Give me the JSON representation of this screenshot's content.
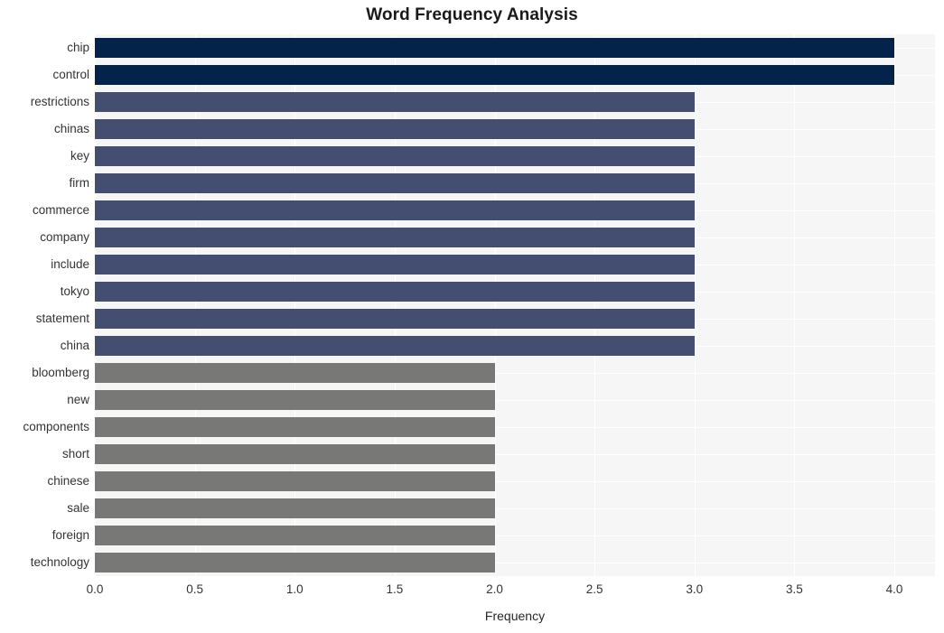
{
  "chart_data": {
    "type": "bar",
    "orientation": "horizontal",
    "title": "Word Frequency Analysis",
    "xlabel": "Frequency",
    "ylabel": "",
    "xlim": [
      0,
      4.0
    ],
    "xticks": [
      "0.0",
      "0.5",
      "1.0",
      "1.5",
      "2.0",
      "2.5",
      "3.0",
      "3.5",
      "4.0"
    ],
    "xtick_values": [
      0.0,
      0.5,
      1.0,
      1.5,
      2.0,
      2.5,
      3.0,
      3.5,
      4.0
    ],
    "grid": true,
    "legend": "none",
    "categories": [
      "chip",
      "control",
      "restrictions",
      "chinas",
      "key",
      "firm",
      "commerce",
      "company",
      "include",
      "tokyo",
      "statement",
      "china",
      "bloomberg",
      "new",
      "components",
      "short",
      "chinese",
      "sale",
      "foreign",
      "technology"
    ],
    "values": [
      4,
      4,
      3,
      3,
      3,
      3,
      3,
      3,
      3,
      3,
      3,
      3,
      2,
      2,
      2,
      2,
      2,
      2,
      2,
      2
    ],
    "bar_colors": [
      "#03234b",
      "#03234b",
      "#434e70",
      "#434e70",
      "#434e70",
      "#434e70",
      "#434e70",
      "#434e70",
      "#434e70",
      "#434e70",
      "#434e70",
      "#434e70",
      "#787876",
      "#787876",
      "#787876",
      "#787876",
      "#787876",
      "#787876",
      "#787876",
      "#787876"
    ]
  },
  "style": {
    "plot_background": "#f6f6f7",
    "grid_color": "#ffffff",
    "figure_background": "#ffffff",
    "title_color": "#1a1a1a",
    "tick_label_color": "#333333"
  }
}
